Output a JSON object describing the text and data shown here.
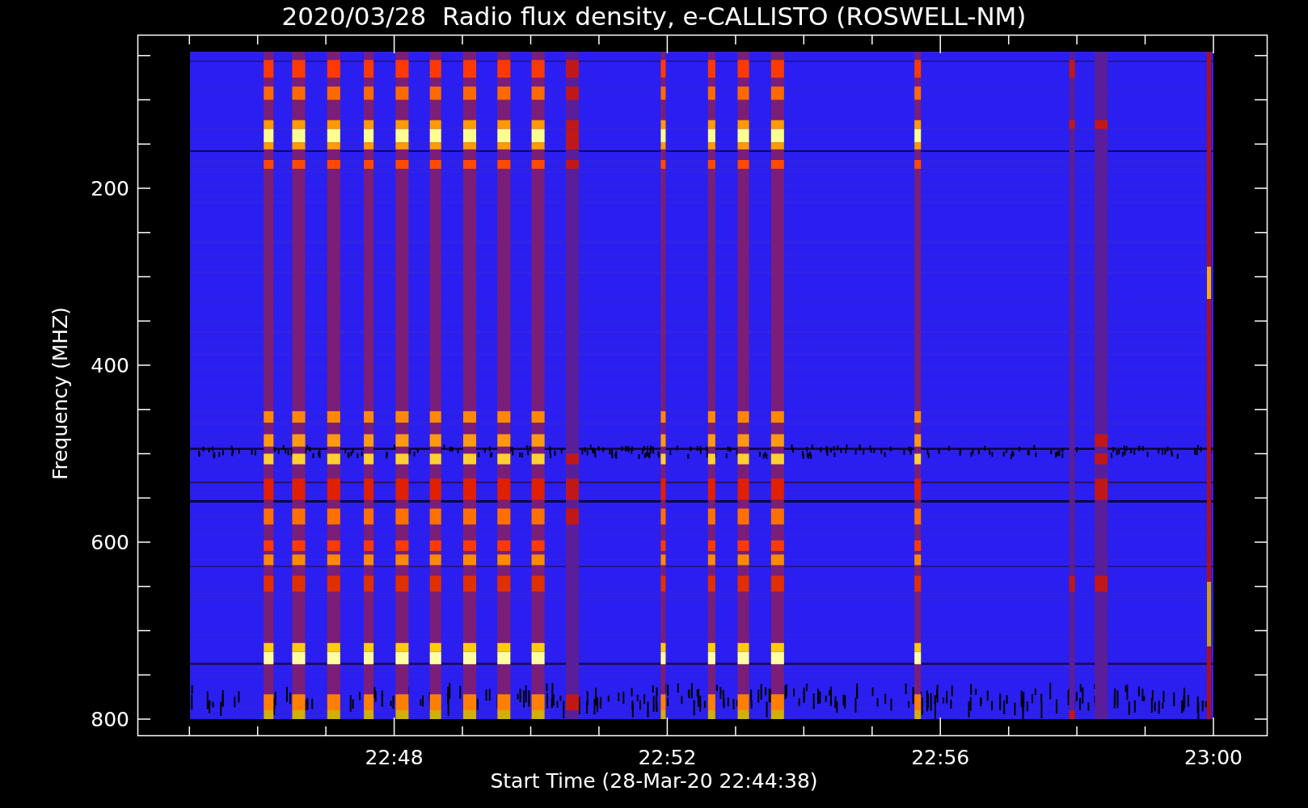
{
  "plot": {
    "title": "2020/03/28  Radio flux density, e-CALLISTO (ROSWELL-NM)",
    "xlabel": "Start Time (28-Mar-20 22:44:38)",
    "ylabel": "Frequency (MHZ)",
    "yticks": [
      "200",
      "400",
      "600",
      "800"
    ],
    "xticks": [
      "22:48",
      "22:52",
      "22:56",
      "23:00"
    ]
  }
}
